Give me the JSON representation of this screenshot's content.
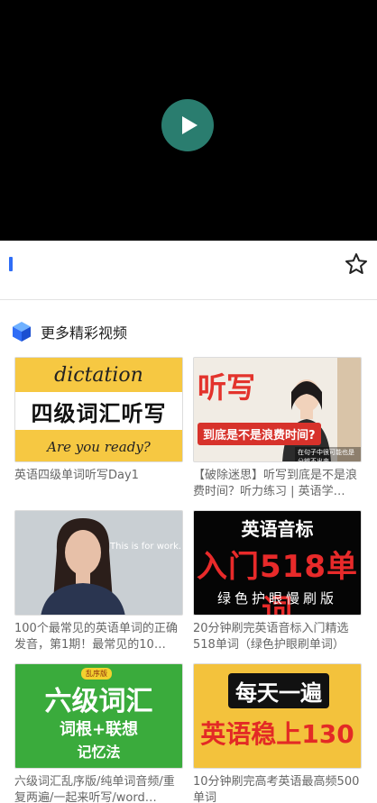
{
  "section": {
    "title": "更多精彩视频"
  },
  "cards": [
    {
      "caption": "英语四级单词听写Day1",
      "thumb": {
        "top": "dictation",
        "mid": "四级词汇听写",
        "bottom": "Are you ready?"
      }
    },
    {
      "caption": "【破除迷思】听写到底是不是浪费时间？听力练习 | 英语学…",
      "thumb": {
        "big": "听写",
        "sub": "到底是不是浪费时间?",
        "small": "在句子中很可能也是分辨不出来"
      }
    },
    {
      "caption": "100个最常见的英语单词的正确发音，第1期！最常见的10…",
      "thumb": {
        "said": "This is for work."
      }
    },
    {
      "caption": "20分钟刷完英语音标入门精选518单词（绿色护眼刷单词）",
      "thumb": {
        "l1": "英语音标",
        "l2": "入门518单词",
        "l3": "绿色护眼慢刷版"
      }
    },
    {
      "caption": "六级词汇乱序版/纯单词音频/重复两遍/一起来听写/word…",
      "thumb": {
        "badge": "乱序版",
        "l1": "六级词汇",
        "l2": "词根+联想",
        "l3": "记忆法"
      }
    },
    {
      "caption": "10分钟刷完高考英语最高频500单词",
      "thumb": {
        "l1": "每天一遍",
        "l2": "英语稳上130"
      }
    }
  ],
  "colors": {
    "accent": "#2f6df6",
    "play": "#2a7d6f"
  }
}
